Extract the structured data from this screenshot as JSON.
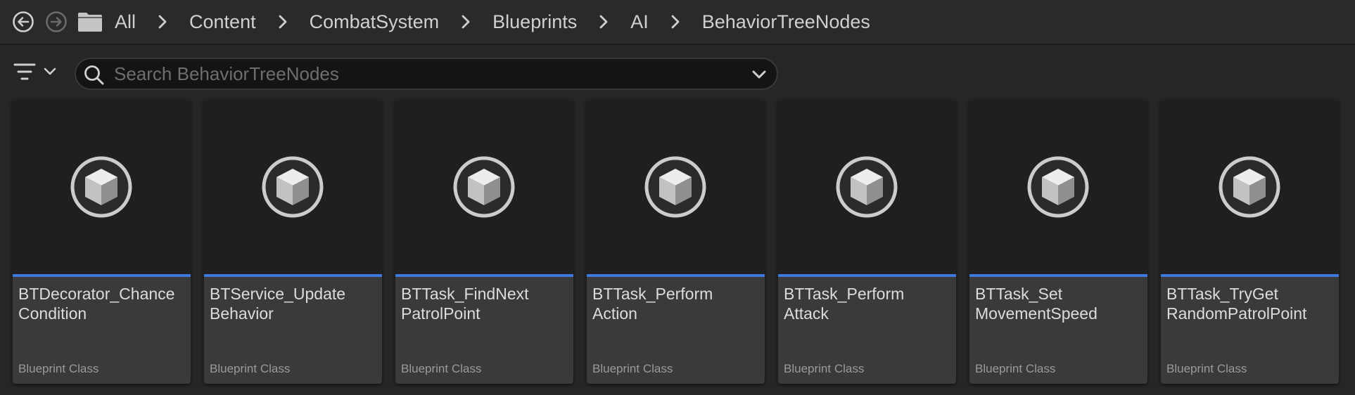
{
  "breadcrumb": {
    "items": [
      "All",
      "Content",
      "CombatSystem",
      "Blueprints",
      "AI",
      "BehaviorTreeNodes"
    ]
  },
  "icons": {
    "back": "circle-arrow-left-icon",
    "forward": "circle-arrow-right-icon",
    "folder": "folder-icon",
    "filter": "filter-icon",
    "search": "search-icon",
    "dropdown": "chevron-down-icon",
    "asset": "blueprint-cube-icon"
  },
  "search": {
    "placeholder": "Search BehaviorTreeNodes",
    "value": ""
  },
  "colors": {
    "accent": "#3d78e0",
    "background": "#262626",
    "thumbnail": "#1f1f1f",
    "card": "#3a3a3a"
  },
  "assets": [
    {
      "name_line1": "BTDecorator_Chance",
      "name_line2": "Condition",
      "type": "Blueprint Class"
    },
    {
      "name_line1": "BTService_Update",
      "name_line2": "Behavior",
      "type": "Blueprint Class"
    },
    {
      "name_line1": "BTTask_FindNext",
      "name_line2": "PatrolPoint",
      "type": "Blueprint Class"
    },
    {
      "name_line1": "BTTask_Perform",
      "name_line2": "Action",
      "type": "Blueprint Class"
    },
    {
      "name_line1": "BTTask_Perform",
      "name_line2": "Attack",
      "type": "Blueprint Class"
    },
    {
      "name_line1": "BTTask_Set",
      "name_line2": "MovementSpeed",
      "type": "Blueprint Class"
    },
    {
      "name_line1": "BTTask_TryGet",
      "name_line2": "RandomPatrolPoint",
      "type": "Blueprint Class"
    }
  ]
}
